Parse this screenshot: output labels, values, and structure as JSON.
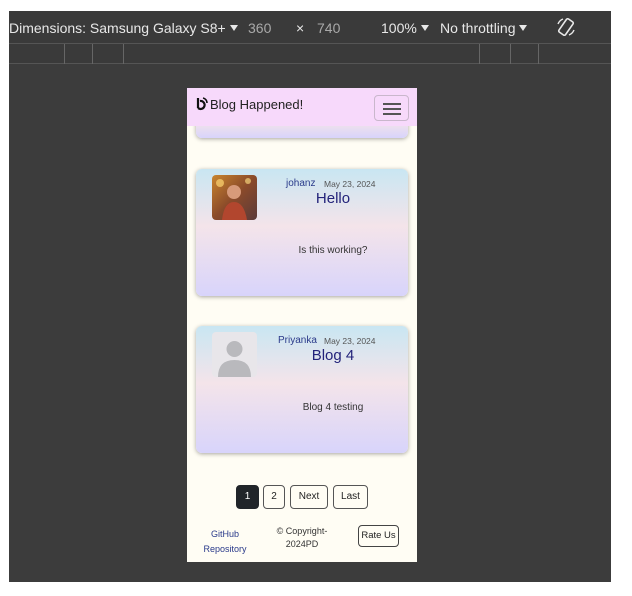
{
  "toolbar": {
    "device_label": "Dimensions: Samsung Galaxy S8+",
    "width": "360",
    "times": "×",
    "height": "740",
    "zoom": "100%",
    "throttling": "No throttling"
  },
  "navbar": {
    "brand": "Blog Happened!"
  },
  "posts": [
    {
      "author": "johanz",
      "date": "May 23, 2024",
      "title": "Hello",
      "body": "Is this working?"
    },
    {
      "author": "Priyanka",
      "date": "May 23, 2024",
      "title": "Blog 4",
      "body": "Blog 4 testing"
    }
  ],
  "pagination": {
    "page1": "1",
    "page2": "2",
    "next": "Next",
    "last": "Last"
  },
  "footer": {
    "link_line1": "GitHub",
    "link_line2": "Repository",
    "copyright_line1": "© Copyright-",
    "copyright_line2": "2024PD",
    "rate": "Rate Us"
  },
  "colors": {
    "navbar": "#f7d9fb",
    "page_bg": "#fffdf4",
    "title": "#23237a",
    "devtools_bg": "#3c3c3c"
  }
}
